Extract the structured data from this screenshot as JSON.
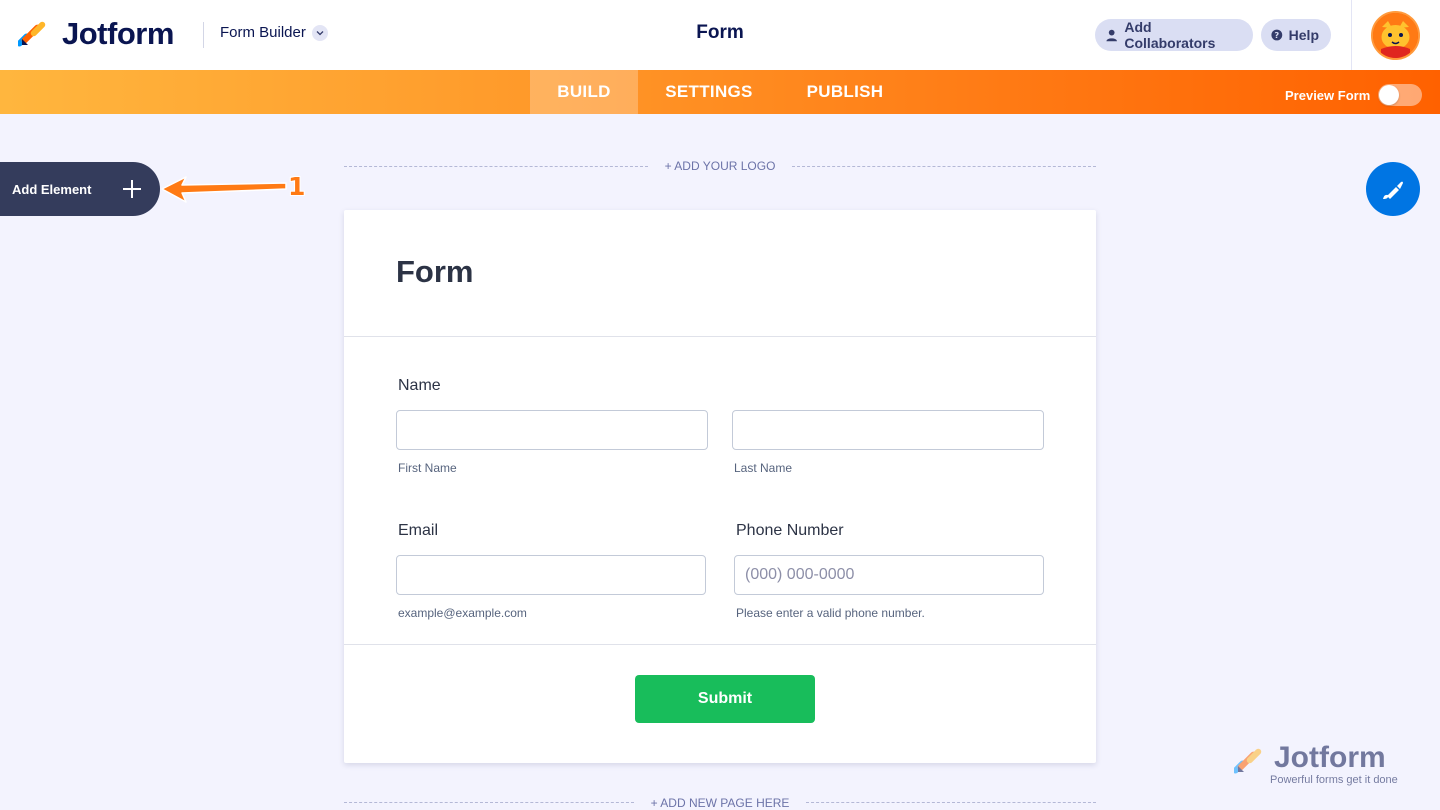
{
  "header": {
    "brand": "Jotform",
    "builder_select": "Form Builder",
    "page_title": "Form",
    "collaborators_label": "Add Collaborators",
    "help_label": "Help"
  },
  "nav": {
    "tabs": [
      "BUILD",
      "SETTINGS",
      "PUBLISH"
    ],
    "active_tab": "BUILD",
    "preview_label": "Preview Form",
    "preview_enabled": false
  },
  "sidebar": {
    "add_element_label": "Add Element"
  },
  "annotation": {
    "number": "1",
    "color": "#ff7a14"
  },
  "canvas": {
    "add_logo": "+ ADD YOUR LOGO",
    "add_page": "+ ADD NEW PAGE HERE"
  },
  "form": {
    "title": "Form",
    "name_label": "Name",
    "first_name_sublabel": "First Name",
    "last_name_sublabel": "Last Name",
    "first_name_value": "",
    "last_name_value": "",
    "email_label": "Email",
    "email_value": "",
    "email_sublabel": "example@example.com",
    "phone_label": "Phone Number",
    "phone_placeholder": "(000) 000-0000",
    "phone_sublabel": "Please enter a valid phone number.",
    "submit_label": "Submit"
  },
  "watermark": {
    "brand": "Jotform",
    "tagline": "Powerful forms get it done"
  },
  "colors": {
    "brand_navy": "#0a1551",
    "nav_orange": "#ff6100",
    "submit_green": "#18bd5b",
    "designer_blue": "#0075e3"
  },
  "icons": [
    "jotform-logo-icon",
    "chevron-down-icon",
    "user-icon",
    "question-icon",
    "avatar-icon",
    "plus-icon",
    "arrow-left-icon",
    "paint-brush-icon"
  ]
}
